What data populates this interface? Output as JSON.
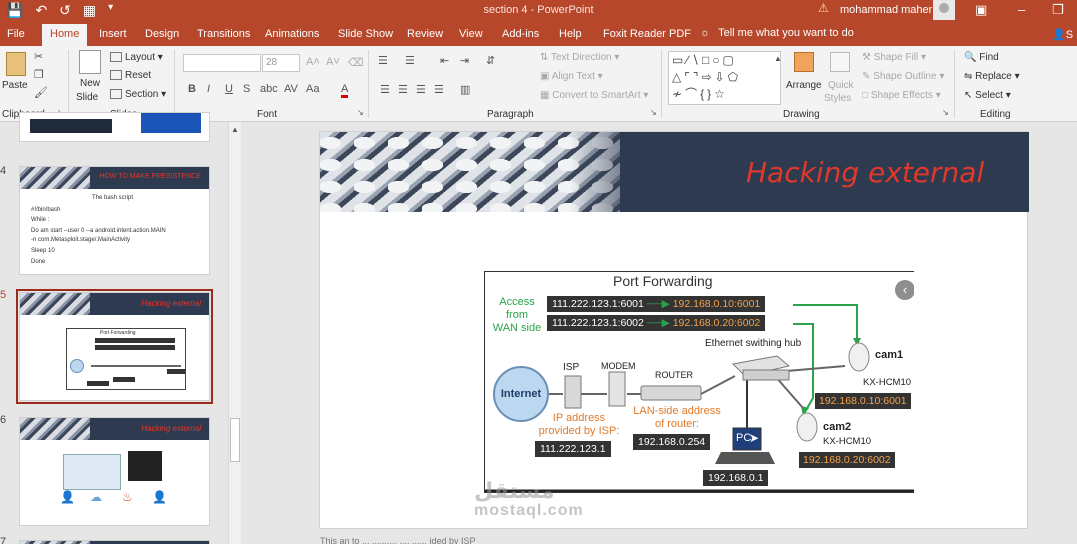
{
  "titlebar": {
    "doc_title": "section 4  -  PowerPoint",
    "user_name": "mohammad maher"
  },
  "tabs": [
    {
      "label": "File"
    },
    {
      "label": "Home"
    },
    {
      "label": "Insert"
    },
    {
      "label": "Design"
    },
    {
      "label": "Transitions"
    },
    {
      "label": "Animations"
    },
    {
      "label": "Slide Show"
    },
    {
      "label": "Review"
    },
    {
      "label": "View"
    },
    {
      "label": "Add-ins"
    },
    {
      "label": "Help"
    },
    {
      "label": "Foxit Reader PDF"
    }
  ],
  "tellme": {
    "text": "Tell me what you want to do"
  },
  "share": {
    "label": "S"
  },
  "ribbon": {
    "clipboard": {
      "group": "Clipboard",
      "paste": "Paste"
    },
    "slides": {
      "group": "Slides",
      "new_slide": "New",
      "new_slide2": "Slide",
      "layout": "Layout",
      "reset": "Reset",
      "section": "Section"
    },
    "font": {
      "group": "Font",
      "size": "28"
    },
    "paragraph": {
      "group": "Paragraph",
      "text_direction": "Text Direction",
      "align_text": "Align Text",
      "smartart": "Convert to SmartArt"
    },
    "drawing": {
      "group": "Drawing",
      "arrange": "Arrange",
      "quick_styles": "Quick",
      "quick_styles2": "Styles",
      "shape_fill": "Shape Fill",
      "shape_outline": "Shape Outline",
      "shape_effects": "Shape Effects"
    },
    "editing": {
      "group": "Editing",
      "find": "Find",
      "replace": "Replace",
      "select": "Select"
    }
  },
  "thumbnails": {
    "slide4": {
      "num": "4",
      "title": "HOW TO MAKE PRESISTENCE",
      "heading": "The bash script",
      "lines": [
        "#!/bin/bash",
        "While :",
        "Do am start --user 0 --a android.intent.action.MAIN",
        "     -n com.Metasploit.stage/.MainActivity",
        "Sleep 10",
        "Done"
      ]
    },
    "slide5": {
      "num": "5",
      "title": "Hacking external",
      "mini": "Port Forwarding"
    },
    "slide6": {
      "num": "6",
      "title": "Hacking external"
    },
    "slide7": {
      "num": "7"
    }
  },
  "slide": {
    "title": "Hacking external",
    "diagram": {
      "title": "Port Forwarding",
      "access_label": [
        "Access",
        "from",
        "WAN side"
      ],
      "rule1_from": "111.222.123.1:6001",
      "rule1_to": "192.168.0.10:6001",
      "rule2_from": "111.222.123.1:6002",
      "rule2_to": "192.168.0.20:6002",
      "internet": "Internet",
      "isp": "ISP",
      "modem": "MODEM",
      "router": "ROUTER",
      "hub": "Ethernet swithing hub",
      "isp_ip_label": [
        "IP address",
        "provided by ISP:"
      ],
      "isp_ip": "111.222.123.1",
      "lan_label": [
        "LAN-side address",
        "of router:"
      ],
      "lan_ip": "192.168.0.254",
      "pc": "PC",
      "pc_ip": "192.168.0.1",
      "cam1": "cam1",
      "cam1_model": "KX-HCM10",
      "cam1_ip": "192.168.0.10:6001",
      "cam2": "cam2",
      "cam2_model": "KX-HCM10",
      "cam2_ip": "192.168.0.20:6002"
    }
  },
  "notes": {
    "text": "This             an                  to        ...      ..........  ....  ......  ided by  ISP"
  },
  "watermark": {
    "main": "مستقل",
    "sub": "mostaql.com"
  },
  "colors": {
    "accent": "#b7472a",
    "title_red": "#e0382b",
    "green": "#2aa34a",
    "orange": "#f4a24c"
  }
}
